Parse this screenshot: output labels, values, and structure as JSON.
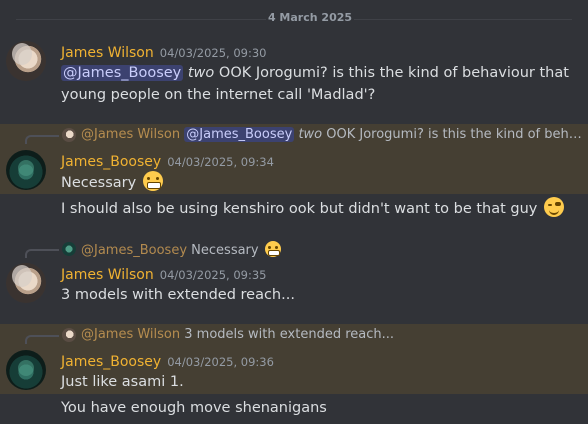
{
  "date_divider": "4 March 2025",
  "messages": [
    {
      "author": "James Wilson",
      "timestamp": "04/03/2025, 09:30",
      "mention": "@James_Boosey",
      "italic": "two",
      "text_line1": " OOK Jorogumi? is this the kind of behaviour that",
      "text_line2": "young people on the internet call 'Madlad'?"
    },
    {
      "reply": {
        "author": "@James Wilson",
        "mention": "@James_Boosey",
        "italic": "two",
        "text": " OOK Jorogumi? is this the kind of behaviou..."
      },
      "author": "James_Boosey",
      "timestamp": "04/03/2025, 09:34",
      "text": "Necessary",
      "emoji": "grimacing-emoji",
      "followup": "I should also be using kenshiro ook but didn't want to be that guy",
      "followup_emoji": "wink-emoji"
    },
    {
      "reply": {
        "author": "@James_Boosey",
        "text": "Necessary",
        "emoji": "grimacing-emoji"
      },
      "author": "James Wilson",
      "timestamp": "04/03/2025, 09:35",
      "text": "3 models with extended reach..."
    },
    {
      "reply": {
        "author": "@James Wilson",
        "text": "3 models with extended reach..."
      },
      "author": "James_Boosey",
      "timestamp": "04/03/2025, 09:36",
      "text": "Just like asami 1.",
      "followup": "You have enough move shenanigans"
    }
  ],
  "colors": {
    "background": "#313338",
    "highlight": "#453f33",
    "username": "#f0b232",
    "mention_bg": "#3c4270"
  }
}
